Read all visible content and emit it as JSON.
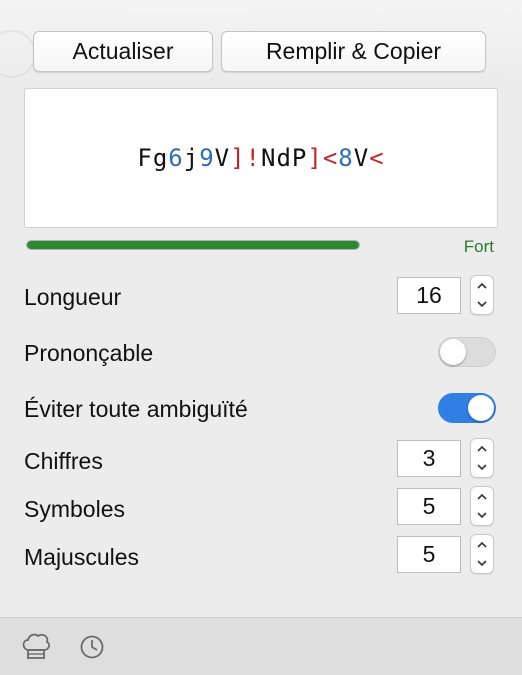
{
  "toolbar": {
    "refresh_label": "Actualiser",
    "fill_copy_label": "Remplir & Copier"
  },
  "password": {
    "characters": [
      {
        "c": "F",
        "kind": "letter"
      },
      {
        "c": "g",
        "kind": "letter"
      },
      {
        "c": "6",
        "kind": "digit"
      },
      {
        "c": "j",
        "kind": "letter"
      },
      {
        "c": "9",
        "kind": "digit"
      },
      {
        "c": "V",
        "kind": "letter"
      },
      {
        "c": "]",
        "kind": "symbol"
      },
      {
        "c": "!",
        "kind": "symbol"
      },
      {
        "c": "N",
        "kind": "letter"
      },
      {
        "c": "d",
        "kind": "letter"
      },
      {
        "c": "P",
        "kind": "letter"
      },
      {
        "c": "]",
        "kind": "symbol"
      },
      {
        "c": "<",
        "kind": "symbol"
      },
      {
        "c": "8",
        "kind": "digit"
      },
      {
        "c": "V",
        "kind": "letter"
      },
      {
        "c": "<",
        "kind": "symbol"
      }
    ],
    "colors": {
      "letter": "#111111",
      "digit": "#2f6db5",
      "symbol": "#c0282d"
    }
  },
  "strength": {
    "label": "Fort",
    "fraction": 1.0,
    "color": "#2b8a2f"
  },
  "options": {
    "length": {
      "label": "Longueur",
      "value": "16"
    },
    "pronounceable": {
      "label": "Prononçable",
      "on": false
    },
    "avoid_ambiguity": {
      "label": "Éviter toute ambiguïté",
      "on": true
    },
    "digits": {
      "label": "Chiffres",
      "value": "3"
    },
    "symbols": {
      "label": "Symboles",
      "value": "5"
    },
    "uppercase": {
      "label": "Majuscules",
      "value": "5"
    }
  },
  "footer": {
    "icons": [
      "chef-hat-icon",
      "clock-icon"
    ]
  },
  "accent_color": "#2f7fe4"
}
